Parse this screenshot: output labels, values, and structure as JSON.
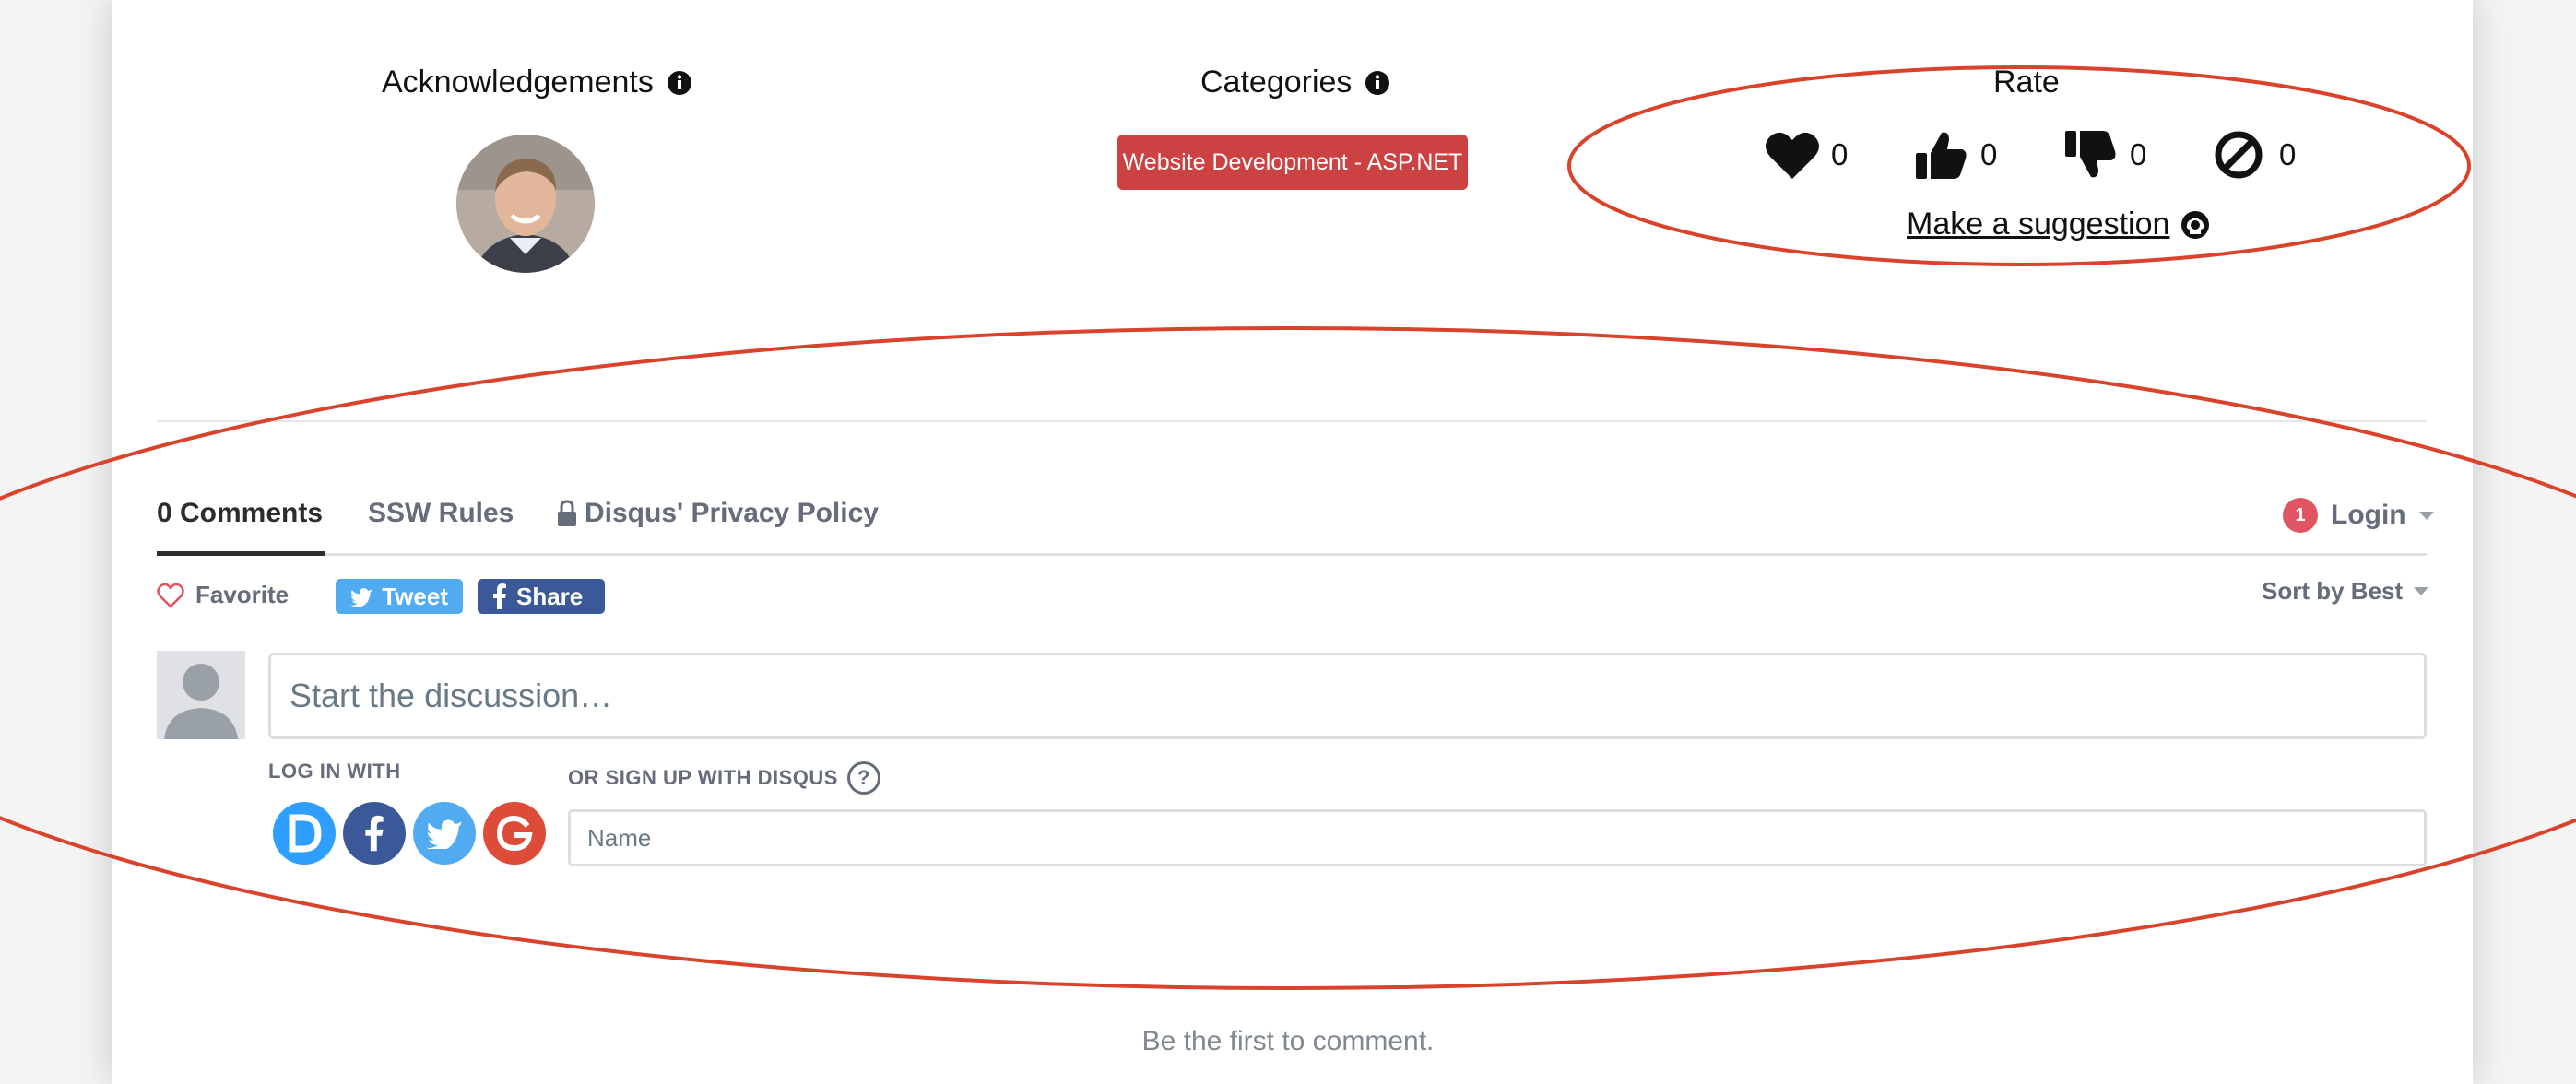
{
  "acknowledgements": {
    "title": "Acknowledgements"
  },
  "categories": {
    "title": "Categories",
    "badge": "Website Development - ASP.NET"
  },
  "rate": {
    "title": "Rate",
    "items": [
      {
        "icon": "heart-icon",
        "count": "0"
      },
      {
        "icon": "thumbs-up-icon",
        "count": "0"
      },
      {
        "icon": "thumbs-down-icon",
        "count": "0"
      },
      {
        "icon": "block-icon",
        "count": "0"
      }
    ],
    "suggestion": "Make a suggestion"
  },
  "comments": {
    "tabs": [
      "0 Comments",
      "SSW Rules",
      "Disqus' Privacy Policy"
    ],
    "login": "Login",
    "notification_count": "1",
    "favorite": "Favorite",
    "tweet": "Tweet",
    "share": "Share",
    "sort": "Sort by Best",
    "discussion_placeholder": "Start the discussion…",
    "login_with": "LOG IN WITH",
    "signup_with": "OR SIGN UP WITH DISQUS",
    "help": "?",
    "name_placeholder": "Name",
    "first": "Be the first to comment."
  },
  "colors": {
    "badge": "#cc4141",
    "twitter": "#50abf1",
    "facebook": "#3b5998",
    "google": "#dd4b39",
    "disqus": "#2e9fff",
    "annotation": "#d9432b"
  }
}
